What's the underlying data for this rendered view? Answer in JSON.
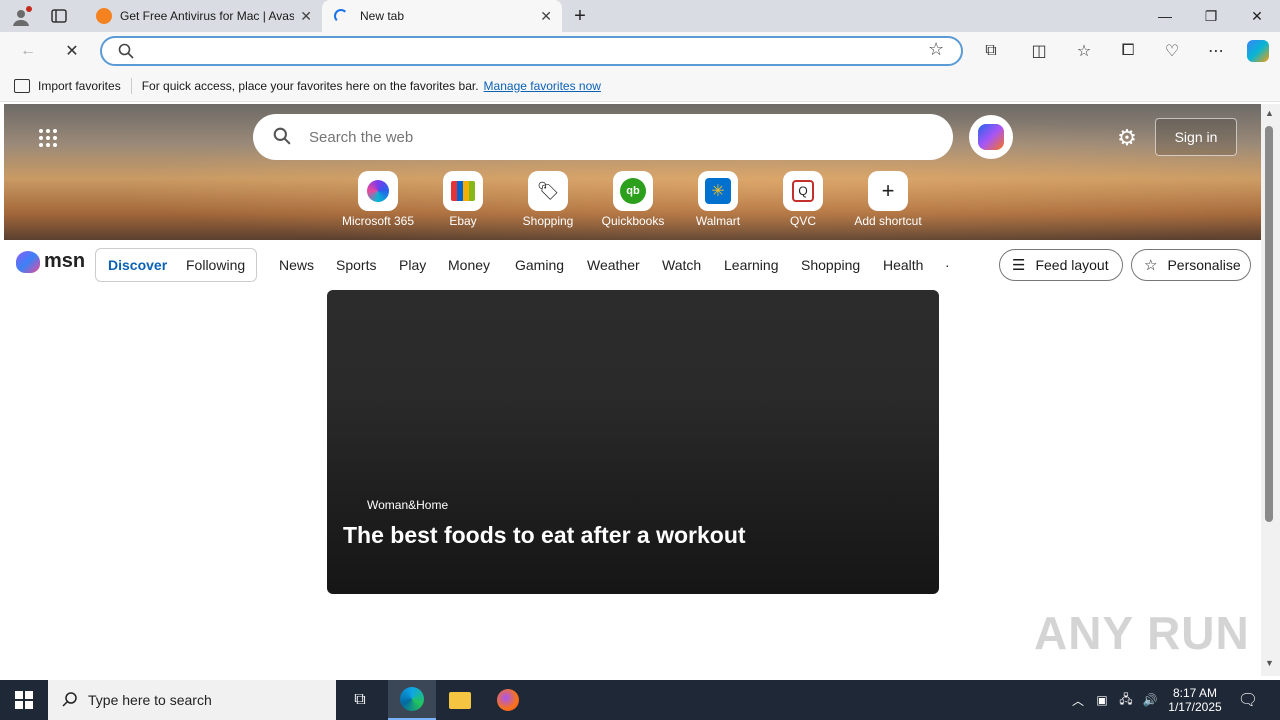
{
  "browser": {
    "tabs": [
      {
        "label": "Get Free Antivirus for Mac | Avast"
      },
      {
        "label": "New tab"
      }
    ],
    "new_tab_icon": "plus-icon",
    "window_controls": [
      "minimize-icon",
      "restore-icon",
      "close-icon"
    ],
    "address": {
      "value": "",
      "placeholder": ""
    }
  },
  "favorites_bar": {
    "import_label": "Import favorites",
    "hint": "For quick access, place your favorites here on the favorites bar.",
    "manage_link": "Manage favorites now"
  },
  "newtab": {
    "search_placeholder": "Search the web",
    "sign_in": "Sign in",
    "shortcuts": [
      {
        "label": "Microsoft 365"
      },
      {
        "label": "Ebay"
      },
      {
        "label": "Shopping"
      },
      {
        "label": "Quickbooks"
      },
      {
        "label": "Walmart"
      },
      {
        "label": "QVC"
      },
      {
        "label": "Add shortcut"
      }
    ]
  },
  "msn": {
    "logo": "msn",
    "segments": [
      "Discover",
      "Following"
    ],
    "nav": [
      "News",
      "Sports",
      "Play",
      "Money",
      "Gaming",
      "Weather",
      "Watch",
      "Learning",
      "Shopping",
      "Health"
    ],
    "feed_layout": "Feed layout",
    "personalise": "Personalise"
  },
  "article": {
    "source": "Woman&Home",
    "headline": "The best foods to eat after a workout"
  },
  "watermark": "ANY RUN",
  "taskbar": {
    "search_placeholder": "Type here to search",
    "time": "8:17 AM",
    "date": "1/17/2025"
  },
  "colors": {
    "accent": "#0b62b5",
    "taskbar": "#1f2836",
    "omnibox_border": "#5b9bd5"
  }
}
